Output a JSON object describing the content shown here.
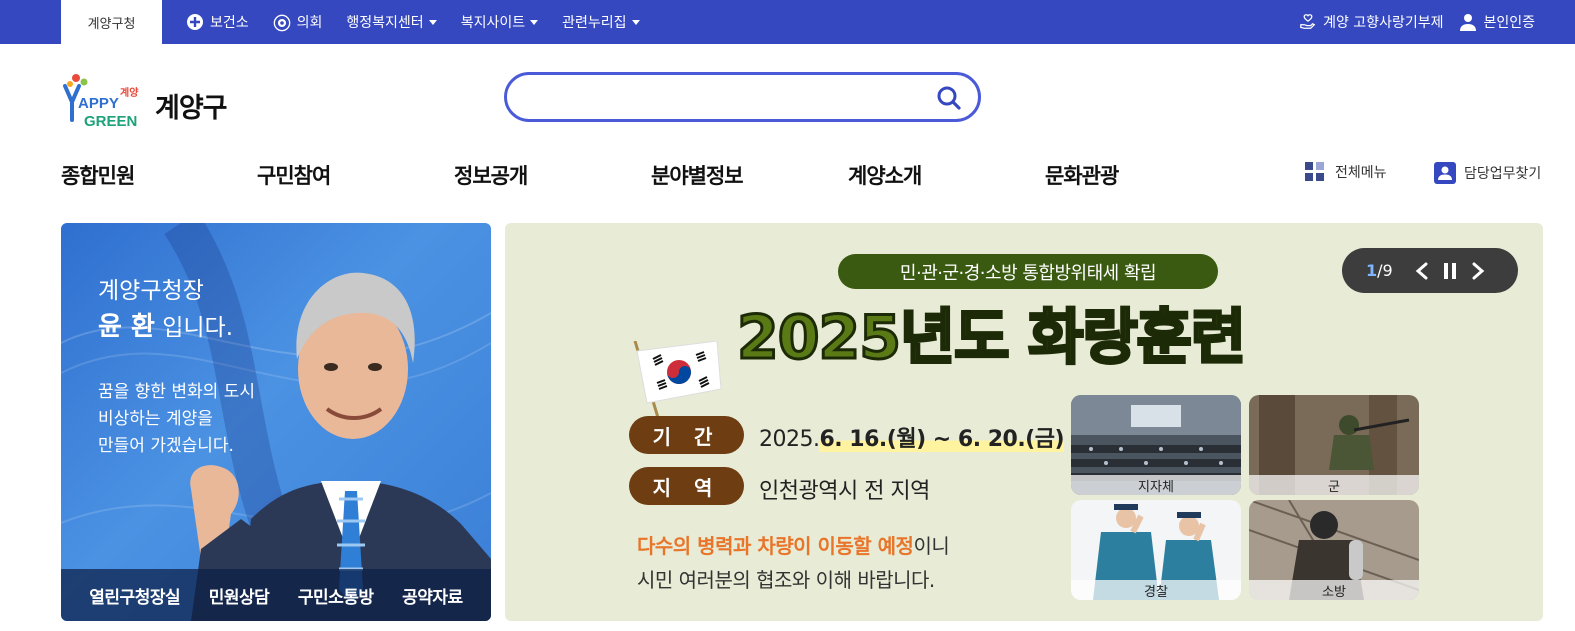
{
  "topbar": {
    "active_tab": "계양구청",
    "links": [
      {
        "label": "보건소",
        "icon": "health-center-icon"
      },
      {
        "label": "의회",
        "icon": "council-emblem-icon"
      },
      {
        "label": "행정복지센터",
        "dropdown": true
      },
      {
        "label": "복지사이트",
        "dropdown": true
      },
      {
        "label": "관련누리집",
        "dropdown": true
      }
    ],
    "right_links": [
      {
        "label": "계양 고향사랑기부제",
        "icon": "donation-hand-icon"
      },
      {
        "label": "본인인증",
        "icon": "user-icon"
      }
    ],
    "colors": {
      "bar": "#3548c0",
      "text": "#ffffff"
    }
  },
  "header": {
    "logo_text_small": "계양",
    "logo_text_happy": "APPY",
    "logo_text_green": "GREEN",
    "title": "계양구",
    "search": {
      "placeholder": "",
      "value": ""
    }
  },
  "nav": {
    "items": [
      "종합민원",
      "구민참여",
      "정보공개",
      "분야별정보",
      "계양소개",
      "문화관광"
    ],
    "all_menu": "전체메뉴",
    "find_duty": "담당업무찾기"
  },
  "mayor": {
    "line1": "계양구청장",
    "name": "윤 환",
    "line2_suffix": " 입니다.",
    "slogan": [
      "꿈을 향한 변화의 도시",
      "비상하는 계양을",
      "만들어 가겠습니다."
    ],
    "links": [
      "열린구청장실",
      "민원상담",
      "구민소통방",
      "공약자료"
    ]
  },
  "banner": {
    "pill": "민·관·군·경·소방 통합방위태세 확립",
    "headline": "2025년도 화랑훈련",
    "period_label": "기 간",
    "period_prefix": "2025.",
    "period_value": "6. 16.(월) ~ 6. 20.(금)",
    "region_label": "지 역",
    "region_value": "인천광역시 전 지역",
    "notice_orange": "다수의 병력과 차량이 이동할 예정",
    "notice_rest1": "이니",
    "notice_line2": "시민 여러분의 협조와 이해 바랍니다.",
    "photos": [
      "지자체",
      "군",
      "경찰",
      "소방"
    ],
    "slider": {
      "current": "1",
      "total": "9",
      "separator": "/"
    }
  }
}
